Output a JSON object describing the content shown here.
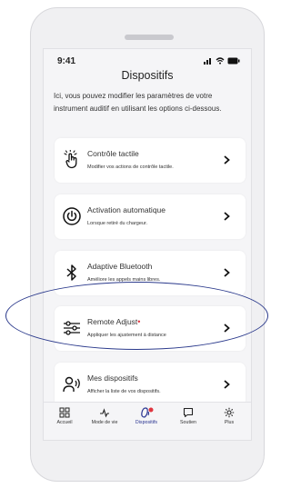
{
  "status": {
    "time": "9:41"
  },
  "header": {
    "title": "Dispositifs"
  },
  "intro": "Ici, vous pouvez modifier les paramètres de votre instrument auditif en utilisant les options ci-dessous.",
  "cards": [
    {
      "name": "Contrôle tactile",
      "desc": "Modifier vos actions de contrôle tactile.",
      "icon": "touch-hand-icon"
    },
    {
      "name": "Activation automatique",
      "desc": "Lorsque retiré du chargeur.",
      "icon": "power-icon"
    },
    {
      "name": "Adaptive Bluetooth",
      "desc": "Améliore les appels mains libres.",
      "icon": "bluetooth-icon"
    },
    {
      "name": "Remote Adjust",
      "desc": "Appliquer les ajustement à distance",
      "icon": "sliders-icon"
    },
    {
      "name": "Mes dispositifs",
      "desc": "Afficher la liste de vos dispositifs.",
      "icon": "hearing-devices-icon"
    }
  ],
  "nav": [
    {
      "label": "Accueil",
      "icon": "grid-icon"
    },
    {
      "label": "Mode de vie",
      "icon": "activity-icon"
    },
    {
      "label": "Dispositifs",
      "icon": "hearing-aid-icon",
      "active": true
    },
    {
      "label": "Soutien",
      "icon": "chat-icon"
    },
    {
      "label": "Plus",
      "icon": "gear-icon"
    }
  ],
  "colors": {
    "accent": "#2a3591",
    "badge": "#e0353f",
    "card": "#ffffff",
    "background": "#f5f5f7"
  }
}
